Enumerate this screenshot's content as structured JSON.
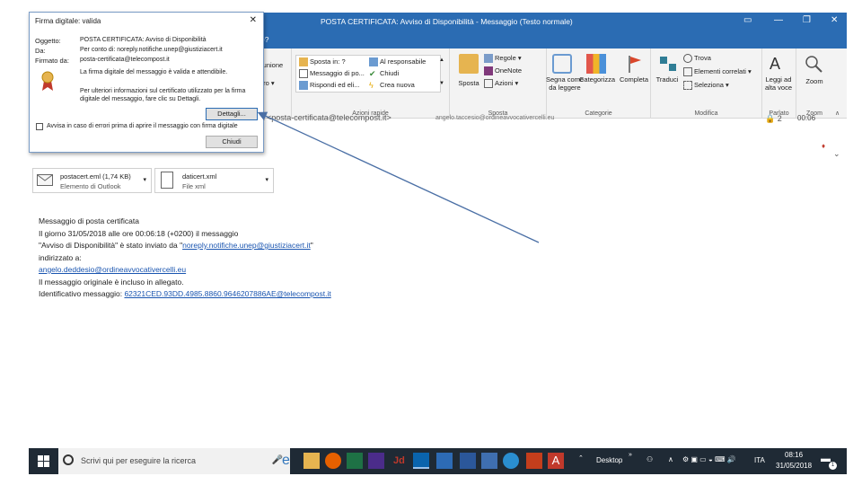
{
  "window": {
    "title": "POSTA CERTIFICATA: Avviso di Disponibilità  -  Messaggio (Testo normale)",
    "tell_me": "e?"
  },
  "ribbon": {
    "riunione": "iunione",
    "altro": "tro ▾",
    "quick_steps": [
      "Sposta in: ?",
      "Messaggio di po...",
      "Rispondi ed eli..."
    ],
    "quick_steps_right": [
      "Al responsabile",
      "Chiudi",
      "Crea nuova"
    ],
    "quick_steps_group": "Azioni rapide",
    "sposta": "Sposta",
    "regole": "Regole ▾",
    "onenote": "OneNote",
    "azioni": "Azioni ▾",
    "sposta_group": "Sposta",
    "segna": [
      "Segna come",
      "da leggere"
    ],
    "categorizza": "Categorizza",
    "completa": "Completa",
    "categorie_group": "Categorie",
    "traduci": "Traduci",
    "trova": "Trova",
    "elementi_correlati": "Elementi correlati ▾",
    "seleziona": "Seleziona ▾",
    "modifica_group": "Modifica",
    "leggi": [
      "Leggi ad",
      "alta voce"
    ],
    "parlato_group": "Parlato",
    "zoom": "Zoom",
    "zoom_group": "Zoom"
  },
  "header": {
    "from": "it <posta-certificata@telecompost.it>",
    "to": "angelo.taccesio@ordineavvocativercelli.eu",
    "count": "2",
    "time": "00:06"
  },
  "attachments": [
    {
      "name": "postacert.eml (1,74 KB)",
      "type": "Elemento di Outlook"
    },
    {
      "name": "daticert.xml",
      "type": "File xml"
    }
  ],
  "body": {
    "line1": "Messaggio di posta certificata",
    "line2": "Il giorno 31/05/2018 alle ore 00:06:18 (+0200) il messaggio",
    "line3_prefix": "\"Avviso di Disponibilità\" è stato inviato da \"",
    "line3_link": "noreply.notifiche.unep@giustiziacert.it",
    "line3_suffix": "\"",
    "line4": "indirizzato a:",
    "line5_link": "angelo.deddesio@ordineavvocativercelli.eu",
    "line6": "Il messaggio originale è incluso in allegato.",
    "line7_prefix": "Identificativo messaggio: ",
    "line7_link": "62321CED.93DD.4985.8860.9646207886AE@telecompost.it"
  },
  "dialog": {
    "title": "Firma digitale: valida",
    "close": "✕",
    "oggetto_label": "Oggetto:",
    "oggetto_value": "POSTA CERTIFICATA: Avviso di Disponibilità",
    "da_label": "Da:",
    "da_value": "Per conto di: noreply.notifiche.unep@giustiziacert.it",
    "firmato_label": "Firmato da:",
    "firmato_value": "posta-certificata@telecompost.it",
    "valid_msg": "La firma digitale del messaggio è valida e attendibile.",
    "info_msg": "Per ulteriori informazioni sul certificato utilizzato per la firma digitale del messaggio, fare clic su Dettagli.",
    "details_button": "Dettagli...",
    "warn_checkbox": "Avvisa in caso di errori prima di aprire il messaggio con firma digitale",
    "close_button": "Chiudi"
  },
  "taskbar": {
    "search_placeholder": "Scrivi qui per eseguire la ricerca",
    "desktop": "Desktop",
    "lang": "ITA",
    "clock_time": "08:16",
    "clock_date": "31/05/2018",
    "notif_count": "1"
  },
  "colors": {
    "titlebar": "#2b6cb3",
    "taskbar": "#1f2a35",
    "arrow": "#4a6fa5",
    "link": "#1a55b0"
  }
}
